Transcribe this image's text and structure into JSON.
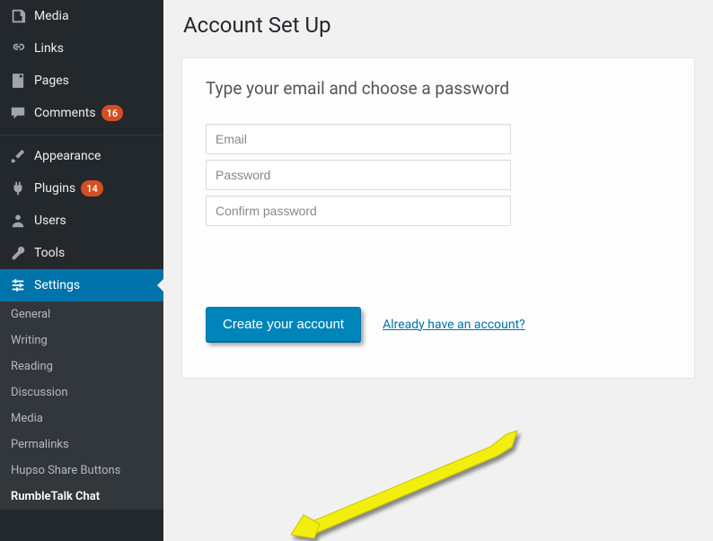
{
  "page": {
    "title": "Account Set Up"
  },
  "sidebar": {
    "top": [
      {
        "label": "Media",
        "icon": "media"
      },
      {
        "label": "Links",
        "icon": "link"
      },
      {
        "label": "Pages",
        "icon": "page"
      },
      {
        "label": "Comments",
        "icon": "comment",
        "badge": "16"
      }
    ],
    "mid": [
      {
        "label": "Appearance",
        "icon": "brush"
      },
      {
        "label": "Plugins",
        "icon": "plugin",
        "badge": "14"
      },
      {
        "label": "Users",
        "icon": "user"
      },
      {
        "label": "Tools",
        "icon": "wrench"
      },
      {
        "label": "Settings",
        "icon": "sliders",
        "active": true
      }
    ],
    "sub": [
      "General",
      "Writing",
      "Reading",
      "Discussion",
      "Media",
      "Permalinks",
      "Hupso Share Buttons",
      "RumbleTalk Chat"
    ],
    "sub_current_index": 7
  },
  "panel": {
    "heading": "Type your email and choose a password",
    "email_placeholder": "Email",
    "password_placeholder": "Password",
    "confirm_placeholder": "Confirm password",
    "create_label": "Create your account",
    "already_label": "Already have an account?"
  },
  "colors": {
    "accent": "#0073aa",
    "badge": "#d54e21",
    "sidebar": "#23282d"
  }
}
